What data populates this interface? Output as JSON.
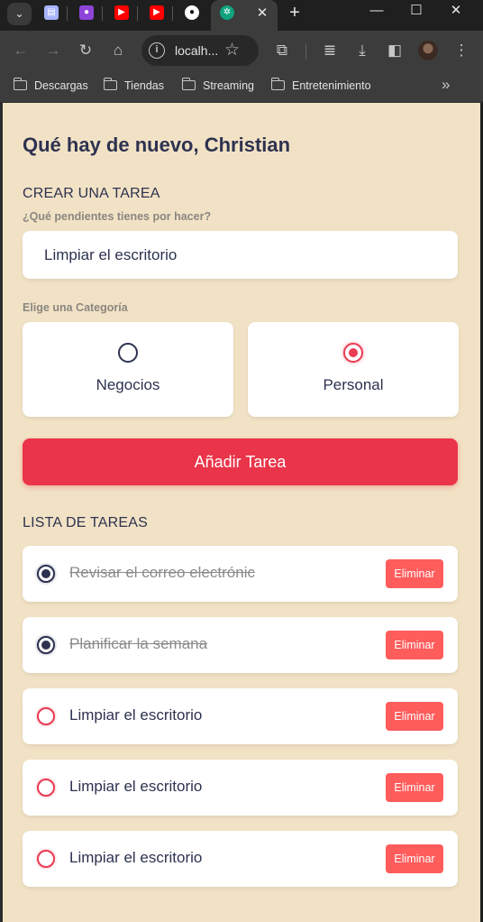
{
  "browser": {
    "tabs": [
      {
        "icon": "document-icon",
        "color": "#a8b4ff"
      },
      {
        "icon": "purple-app-icon",
        "color": "#8e44d9"
      },
      {
        "icon": "youtube-icon",
        "color": "#ff0000"
      },
      {
        "icon": "youtube-icon",
        "color": "#ff0000"
      },
      {
        "icon": "github-icon",
        "color": "#ffffff"
      },
      {
        "icon": "chatgpt-icon",
        "color": "#10a37f"
      }
    ],
    "url": "localh...",
    "bookmarks": [
      "Descargas",
      "Tiendas",
      "Streaming",
      "Entretenimiento"
    ]
  },
  "app": {
    "greeting": "Qué hay de nuevo, Christian",
    "create_title": "CREAR UNA TAREA",
    "input_label": "¿Qué pendientes tienes por hacer?",
    "input_value": "Limpiar el escritorio",
    "category_label": "Elige una Categoría",
    "categories": [
      {
        "label": "Negocios",
        "selected": false
      },
      {
        "label": "Personal",
        "selected": true
      }
    ],
    "add_button": "Añadir Tarea",
    "list_title": "LISTA DE TAREAS",
    "delete_label": "Eliminar",
    "todos": [
      {
        "text": "Revisar el correo electrónic",
        "done": true
      },
      {
        "text": "Planificar la semana",
        "done": true
      },
      {
        "text": "Limpiar el escritorio",
        "done": false
      },
      {
        "text": "Limpiar el escritorio",
        "done": false
      },
      {
        "text": "Limpiar el escritorio",
        "done": false
      }
    ],
    "colors": {
      "accent": "#ea3449",
      "delete": "#ff5c5c",
      "background": "#f2e2c5",
      "text": "#2d3250"
    }
  }
}
